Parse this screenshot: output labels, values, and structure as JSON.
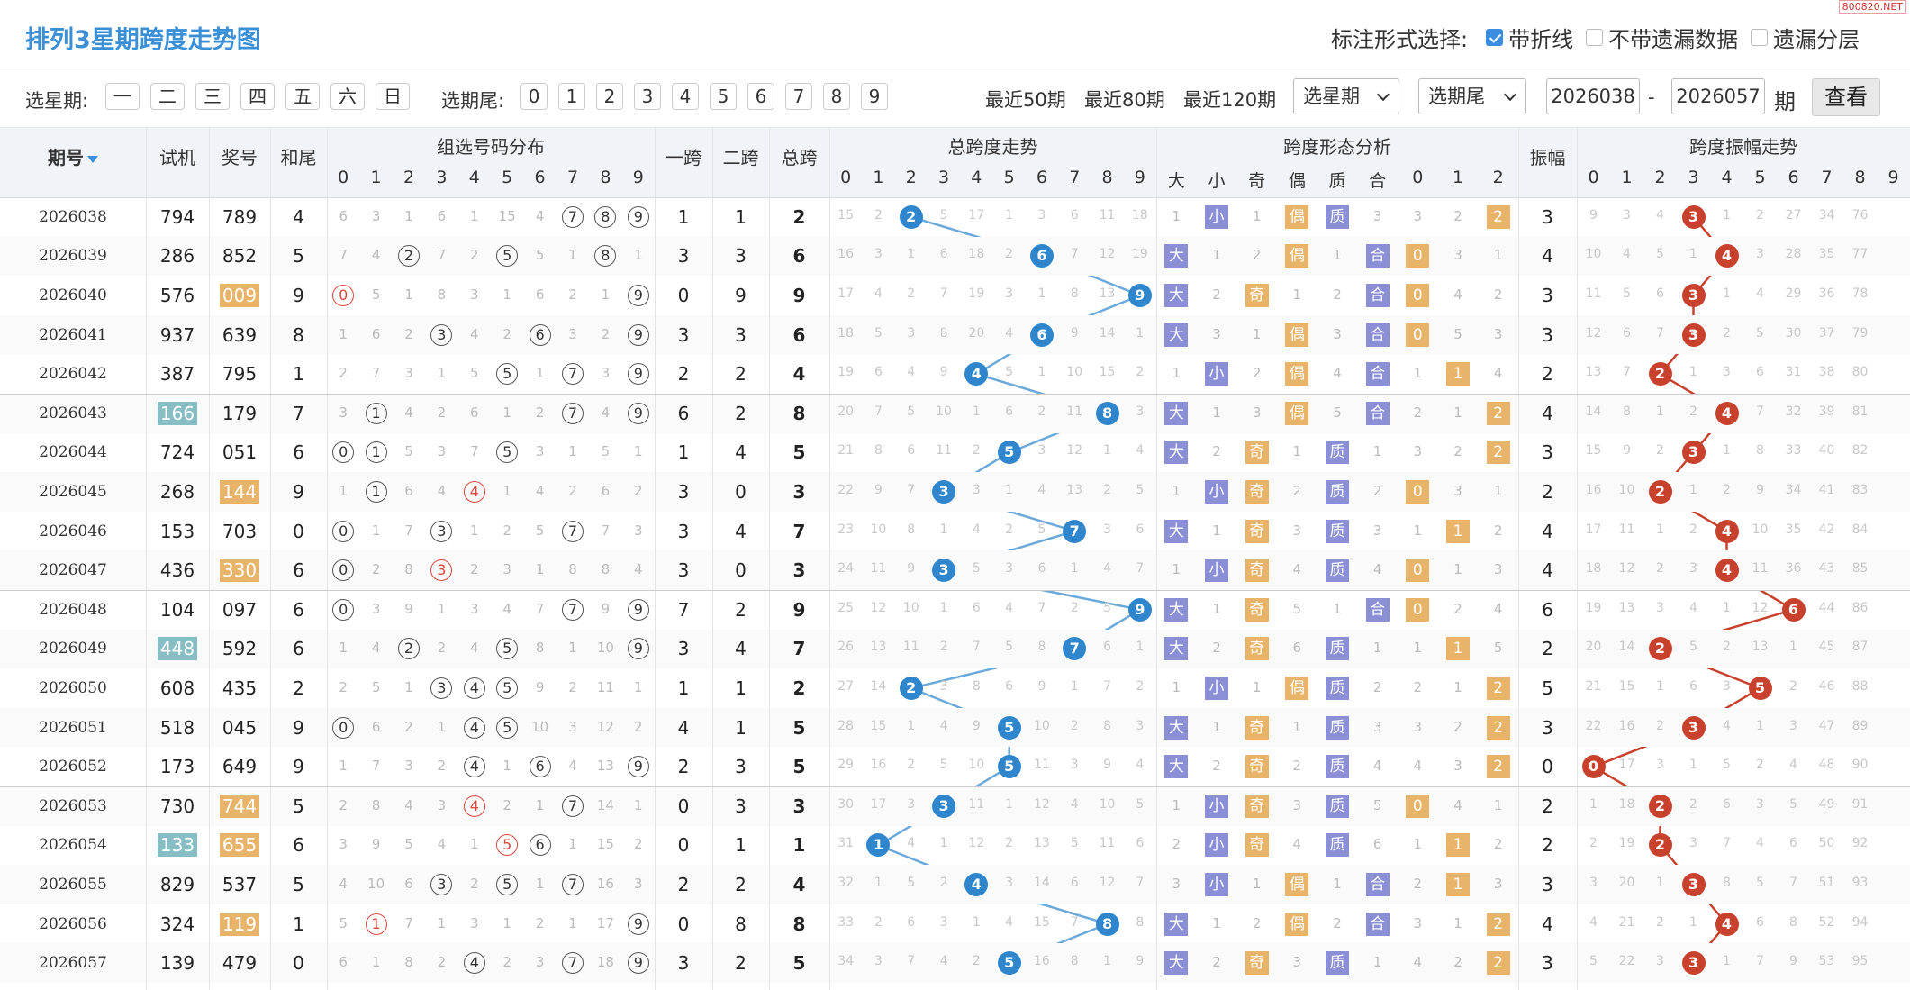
{
  "header": {
    "title": "排列3星期跨度走势图",
    "mark_label": "标注形式选择:",
    "opt_line": "带折线",
    "opt_nomiss": "不带遗漏数据",
    "opt_layer": "遗漏分层",
    "watermark": "800820.NET"
  },
  "toolbar": {
    "week_label": "选星期:",
    "weeks": [
      "一",
      "二",
      "三",
      "四",
      "五",
      "六",
      "日"
    ],
    "tail_label": "选期尾:",
    "tails": [
      "0",
      "1",
      "2",
      "3",
      "4",
      "5",
      "6",
      "7",
      "8",
      "9"
    ],
    "recent": [
      "最近50期",
      "最近80期",
      "最近120期"
    ],
    "sel_week": "选星期",
    "sel_tail": "选期尾",
    "from": "2026038",
    "dash": "-",
    "to": "2026057",
    "unit": "期",
    "go": "查看"
  },
  "cols": {
    "period": "期号",
    "test": "试机",
    "prize": "奖号",
    "tail": "和尾",
    "dist": "组选号码分布",
    "s1": "一跨",
    "s2": "二跨",
    "total": "总跨",
    "trend": "总跨度走势",
    "form": "跨度形态分析",
    "amp": "振幅",
    "amptrend": "跨度振幅走势",
    "digits": [
      "0",
      "1",
      "2",
      "3",
      "4",
      "5",
      "6",
      "7",
      "8",
      "9"
    ],
    "form_sub": [
      "大",
      "小",
      "奇",
      "偶",
      "质",
      "合",
      "0",
      "1",
      "2"
    ]
  },
  "rows": [
    {
      "p": "2026038",
      "t": "794",
      "z": "789",
      "w": "4",
      "a": "1",
      "b": "1",
      "s": "2",
      "amp": "3",
      "zr": [
        6,
        3,
        1,
        6,
        1,
        15,
        4,
        "#7",
        "#8",
        "#9"
      ],
      "tr": [
        15,
        2,
        "@2",
        5,
        17,
        1,
        3,
        6,
        11,
        18
      ],
      "fm": [
        1,
        "小",
        1,
        "偶",
        "质",
        3,
        3,
        2,
        "2"
      ],
      "am": [
        9,
        3,
        4,
        "@3",
        1,
        2,
        27,
        34,
        76
      ],
      "ztag": "",
      "ttag": ""
    },
    {
      "p": "2026039",
      "t": "286",
      "z": "852",
      "w": "5",
      "a": "3",
      "b": "3",
      "s": "6",
      "amp": "4",
      "zr": [
        7,
        4,
        "#2",
        7,
        2,
        "#5",
        5,
        1,
        "#8",
        1
      ],
      "tr": [
        16,
        3,
        1,
        6,
        18,
        2,
        "@6",
        7,
        12,
        19
      ],
      "fm": [
        "大",
        1,
        2,
        "偶",
        1,
        "合",
        "0",
        3,
        1
      ],
      "am": [
        10,
        4,
        5,
        1,
        "@4",
        3,
        28,
        35,
        77
      ],
      "ztag": "",
      "ttag": ""
    },
    {
      "p": "2026040",
      "t": "576",
      "z": "009",
      "w": "9",
      "a": "0",
      "b": "9",
      "s": "9",
      "amp": "3",
      "zr": [
        "!0",
        5,
        1,
        8,
        3,
        1,
        6,
        2,
        1,
        "#9"
      ],
      "tr": [
        17,
        4,
        2,
        7,
        19,
        3,
        1,
        8,
        13,
        "@9"
      ],
      "fm": [
        "大",
        2,
        "奇",
        1,
        2,
        "合",
        "0",
        4,
        2
      ],
      "am": [
        11,
        5,
        6,
        "@3",
        1,
        4,
        29,
        36,
        78
      ],
      "ztag": "or",
      "ttag": ""
    },
    {
      "p": "2026041",
      "t": "937",
      "z": "639",
      "w": "8",
      "a": "3",
      "b": "3",
      "s": "6",
      "amp": "3",
      "zr": [
        1,
        6,
        2,
        "#3",
        4,
        2,
        "#6",
        3,
        2,
        "#9"
      ],
      "tr": [
        18,
        5,
        3,
        8,
        20,
        4,
        "@6",
        9,
        14,
        1
      ],
      "fm": [
        "大",
        3,
        1,
        "偶",
        3,
        "合",
        "0",
        5,
        3
      ],
      "am": [
        12,
        6,
        7,
        "@3",
        2,
        5,
        30,
        37,
        79
      ],
      "ztag": "",
      "ttag": ""
    },
    {
      "p": "2026042",
      "t": "387",
      "z": "795",
      "w": "1",
      "a": "2",
      "b": "2",
      "s": "4",
      "amp": "2",
      "zr": [
        2,
        7,
        3,
        1,
        5,
        "#5",
        1,
        "#7",
        3,
        "#9"
      ],
      "tr": [
        19,
        6,
        4,
        9,
        "@4",
        5,
        1,
        10,
        15,
        2
      ],
      "fm": [
        1,
        "小",
        2,
        "偶",
        4,
        "合",
        1,
        "1",
        4
      ],
      "am": [
        13,
        7,
        "@2",
        1,
        3,
        6,
        31,
        38,
        80
      ],
      "ztag": "",
      "ttag": ""
    },
    {
      "p": "2026043",
      "t": "166",
      "z": "179",
      "w": "7",
      "a": "6",
      "b": "2",
      "s": "8",
      "amp": "4",
      "zr": [
        3,
        "#1",
        4,
        2,
        6,
        1,
        2,
        "#7",
        4,
        "#9"
      ],
      "tr": [
        20,
        7,
        5,
        10,
        1,
        6,
        2,
        11,
        "@8",
        3
      ],
      "fm": [
        "大",
        1,
        3,
        "偶",
        5,
        "合",
        2,
        1,
        "2"
      ],
      "am": [
        14,
        8,
        1,
        2,
        "@4",
        7,
        32,
        39,
        81
      ],
      "ztag": "",
      "ttag": "tl"
    },
    {
      "p": "2026044",
      "t": "724",
      "z": "051",
      "w": "6",
      "a": "1",
      "b": "4",
      "s": "5",
      "amp": "3",
      "zr": [
        "#0",
        "#1",
        5,
        3,
        7,
        "#5",
        3,
        1,
        5,
        1
      ],
      "tr": [
        21,
        8,
        6,
        11,
        2,
        "@5",
        3,
        12,
        1,
        4
      ],
      "fm": [
        "大",
        2,
        "奇",
        1,
        "质",
        1,
        3,
        2,
        "2"
      ],
      "am": [
        15,
        9,
        2,
        "@3",
        1,
        8,
        33,
        40,
        82
      ],
      "ztag": "",
      "ttag": ""
    },
    {
      "p": "2026045",
      "t": "268",
      "z": "144",
      "w": "9",
      "a": "3",
      "b": "0",
      "s": "3",
      "amp": "2",
      "zr": [
        1,
        "#1",
        6,
        4,
        "!4",
        1,
        4,
        2,
        6,
        2
      ],
      "tr": [
        22,
        9,
        7,
        "@3",
        3,
        1,
        4,
        13,
        2,
        5
      ],
      "fm": [
        1,
        "小",
        "奇",
        2,
        "质",
        2,
        "0",
        3,
        1
      ],
      "am": [
        16,
        10,
        "@2",
        1,
        2,
        9,
        34,
        41,
        83
      ],
      "ztag": "or",
      "ttag": ""
    },
    {
      "p": "2026046",
      "t": "153",
      "z": "703",
      "w": "0",
      "a": "3",
      "b": "4",
      "s": "7",
      "amp": "4",
      "zr": [
        "#0",
        1,
        7,
        "#3",
        1,
        2,
        5,
        "#7",
        7,
        3
      ],
      "tr": [
        23,
        10,
        8,
        1,
        4,
        2,
        5,
        "@7",
        3,
        6
      ],
      "fm": [
        "大",
        1,
        "奇",
        3,
        "质",
        3,
        1,
        "1",
        2
      ],
      "am": [
        17,
        11,
        1,
        2,
        "@4",
        10,
        35,
        42,
        84
      ],
      "ztag": "",
      "ttag": ""
    },
    {
      "p": "2026047",
      "t": "436",
      "z": "330",
      "w": "6",
      "a": "3",
      "b": "0",
      "s": "3",
      "amp": "4",
      "zr": [
        "#0",
        2,
        8,
        "!3",
        2,
        3,
        1,
        8,
        8,
        4
      ],
      "tr": [
        24,
        11,
        9,
        "@3",
        5,
        3,
        6,
        1,
        4,
        7
      ],
      "fm": [
        1,
        "小",
        "奇",
        4,
        "质",
        4,
        "0",
        1,
        3
      ],
      "am": [
        18,
        12,
        2,
        3,
        "@4",
        11,
        36,
        43,
        85
      ],
      "ztag": "or",
      "ttag": ""
    },
    {
      "p": "2026048",
      "t": "104",
      "z": "097",
      "w": "6",
      "a": "7",
      "b": "2",
      "s": "9",
      "amp": "6",
      "zr": [
        "#0",
        3,
        9,
        1,
        3,
        4,
        7,
        "#7",
        9,
        "#9"
      ],
      "tr": [
        25,
        12,
        10,
        1,
        6,
        4,
        7,
        2,
        5,
        "@9"
      ],
      "fm": [
        "大",
        1,
        "奇",
        5,
        1,
        "合",
        "0",
        2,
        4
      ],
      "am": [
        19,
        13,
        3,
        4,
        1,
        12,
        "@6",
        44,
        86
      ],
      "ztag": "",
      "ttag": ""
    },
    {
      "p": "2026049",
      "t": "448",
      "z": "592",
      "w": "6",
      "a": "3",
      "b": "4",
      "s": "7",
      "amp": "2",
      "zr": [
        1,
        4,
        "#2",
        2,
        4,
        "#5",
        8,
        1,
        10,
        "#9"
      ],
      "tr": [
        26,
        13,
        11,
        2,
        7,
        5,
        8,
        "@7",
        6,
        1
      ],
      "fm": [
        "大",
        2,
        "奇",
        6,
        "质",
        1,
        1,
        "1",
        5
      ],
      "am": [
        20,
        14,
        "@2",
        5,
        2,
        13,
        1,
        45,
        87
      ],
      "ztag": "",
      "ttag": "tl"
    },
    {
      "p": "2026050",
      "t": "608",
      "z": "435",
      "w": "2",
      "a": "1",
      "b": "1",
      "s": "2",
      "amp": "5",
      "zr": [
        2,
        5,
        1,
        "#3",
        "#4",
        "#5",
        9,
        2,
        11,
        1
      ],
      "tr": [
        27,
        14,
        "@2",
        3,
        8,
        6,
        9,
        1,
        7,
        2
      ],
      "fm": [
        1,
        "小",
        1,
        "偶",
        "质",
        2,
        2,
        1,
        "2"
      ],
      "am": [
        21,
        15,
        1,
        6,
        3,
        "@5",
        2,
        46,
        88
      ],
      "ztag": "",
      "ttag": ""
    },
    {
      "p": "2026051",
      "t": "518",
      "z": "045",
      "w": "9",
      "a": "4",
      "b": "1",
      "s": "5",
      "amp": "3",
      "zr": [
        "#0",
        6,
        2,
        1,
        "#4",
        "#5",
        10,
        3,
        12,
        2
      ],
      "tr": [
        28,
        15,
        1,
        4,
        9,
        "@5",
        10,
        2,
        8,
        3
      ],
      "fm": [
        "大",
        1,
        "奇",
        1,
        "质",
        3,
        3,
        2,
        "2"
      ],
      "am": [
        22,
        16,
        2,
        "@3",
        4,
        1,
        3,
        47,
        89
      ],
      "ztag": "",
      "ttag": ""
    },
    {
      "p": "2026052",
      "t": "173",
      "z": "649",
      "w": "9",
      "a": "2",
      "b": "3",
      "s": "5",
      "amp": "0",
      "zr": [
        1,
        7,
        3,
        2,
        "#4",
        1,
        "#6",
        4,
        13,
        "#9"
      ],
      "tr": [
        29,
        16,
        2,
        5,
        10,
        "@5",
        11,
        3,
        9,
        4
      ],
      "fm": [
        "大",
        2,
        "奇",
        2,
        "质",
        4,
        4,
        3,
        "2"
      ],
      "am": [
        "@0",
        17,
        3,
        1,
        5,
        2,
        4,
        48,
        90
      ],
      "ztag": "",
      "ttag": ""
    },
    {
      "p": "2026053",
      "t": "730",
      "z": "744",
      "w": "5",
      "a": "0",
      "b": "3",
      "s": "3",
      "amp": "2",
      "zr": [
        2,
        8,
        4,
        3,
        "!4",
        2,
        1,
        "#7",
        14,
        1
      ],
      "tr": [
        30,
        17,
        3,
        "@3",
        11,
        1,
        12,
        4,
        10,
        5
      ],
      "fm": [
        1,
        "小",
        "奇",
        3,
        "质",
        5,
        "0",
        4,
        1
      ],
      "am": [
        1,
        18,
        "@2",
        2,
        6,
        3,
        5,
        49,
        91
      ],
      "ztag": "or",
      "ttag": ""
    },
    {
      "p": "2026054",
      "t": "133",
      "z": "655",
      "w": "6",
      "a": "0",
      "b": "1",
      "s": "1",
      "amp": "2",
      "zr": [
        3,
        9,
        5,
        4,
        1,
        "!5",
        "#6",
        1,
        15,
        2
      ],
      "tr": [
        31,
        "@1",
        4,
        1,
        12,
        2,
        13,
        5,
        11,
        6
      ],
      "fm": [
        2,
        "小",
        "奇",
        4,
        "质",
        6,
        1,
        "1",
        2
      ],
      "am": [
        2,
        19,
        "@2",
        3,
        7,
        4,
        6,
        50,
        92
      ],
      "ztag": "or",
      "ttag": "tl"
    },
    {
      "p": "2026055",
      "t": "829",
      "z": "537",
      "w": "5",
      "a": "2",
      "b": "2",
      "s": "4",
      "amp": "3",
      "zr": [
        4,
        10,
        6,
        "#3",
        2,
        "#5",
        1,
        "#7",
        16,
        3
      ],
      "tr": [
        32,
        1,
        5,
        2,
        "@4",
        3,
        14,
        6,
        12,
        7
      ],
      "fm": [
        3,
        "小",
        1,
        "偶",
        1,
        "合",
        2,
        "1",
        3
      ],
      "am": [
        3,
        20,
        1,
        "@3",
        8,
        5,
        7,
        51,
        93
      ],
      "ztag": "",
      "ttag": ""
    },
    {
      "p": "2026056",
      "t": "324",
      "z": "119",
      "w": "1",
      "a": "0",
      "b": "8",
      "s": "8",
      "amp": "4",
      "zr": [
        5,
        "!1",
        7,
        1,
        3,
        1,
        2,
        1,
        17,
        "#9"
      ],
      "tr": [
        33,
        2,
        6,
        3,
        1,
        4,
        15,
        7,
        "@8",
        8
      ],
      "fm": [
        "大",
        1,
        2,
        "偶",
        2,
        "合",
        3,
        1,
        "2"
      ],
      "am": [
        4,
        21,
        2,
        1,
        "@4",
        6,
        8,
        52,
        94
      ],
      "ztag": "or",
      "ttag": ""
    },
    {
      "p": "2026057",
      "t": "139",
      "z": "479",
      "w": "0",
      "a": "3",
      "b": "2",
      "s": "5",
      "amp": "3",
      "zr": [
        6,
        1,
        8,
        2,
        "#4",
        2,
        3,
        "#7",
        18,
        "#9"
      ],
      "tr": [
        34,
        3,
        7,
        4,
        2,
        "@5",
        16,
        8,
        1,
        9
      ],
      "fm": [
        "大",
        2,
        "奇",
        3,
        "质",
        1,
        4,
        2,
        "2"
      ],
      "am": [
        5,
        22,
        3,
        "@3",
        1,
        7,
        9,
        53,
        95
      ],
      "ztag": "",
      "ttag": ""
    }
  ]
}
